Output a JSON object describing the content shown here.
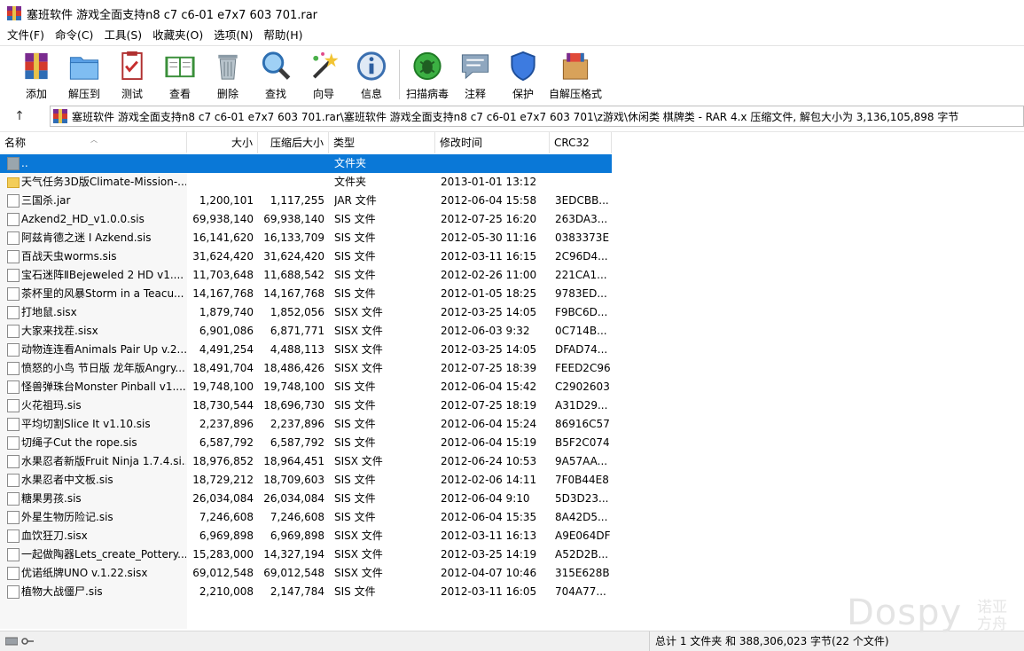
{
  "window": {
    "title": "塞班软件 游戏全面支持n8 c7 c6-01 e7x7 603 701.rar"
  },
  "menu": [
    "文件(F)",
    "命令(C)",
    "工具(S)",
    "收藏夹(O)",
    "选项(N)",
    "帮助(H)"
  ],
  "toolbar": [
    {
      "label": "添加",
      "icon": "add-archive-icon"
    },
    {
      "label": "解压到",
      "icon": "extract-to-icon"
    },
    {
      "label": "测试",
      "icon": "test-icon"
    },
    {
      "label": "查看",
      "icon": "view-icon"
    },
    {
      "label": "删除",
      "icon": "delete-icon"
    },
    {
      "label": "查找",
      "icon": "find-icon"
    },
    {
      "label": "向导",
      "icon": "wizard-icon"
    },
    {
      "label": "信息",
      "icon": "info-icon"
    },
    {
      "label": "扫描病毒",
      "icon": "virus-scan-icon"
    },
    {
      "label": "注释",
      "icon": "comment-icon"
    },
    {
      "label": "保护",
      "icon": "protect-icon"
    },
    {
      "label": "自解压格式",
      "icon": "sfx-icon"
    }
  ],
  "address": {
    "up_arrow": "↑",
    "path": "塞班软件 游戏全面支持n8 c7 c6-01 e7x7 603 701.rar\\塞班软件 游戏全面支持n8 c7 c6-01 e7x7 603 701\\z游戏\\休闲类 棋牌类 - RAR 4.x 压缩文件, 解包大小为 3,136,105,898 字节"
  },
  "columns": {
    "name": "名称",
    "size": "大小",
    "packed": "压缩后大小",
    "type": "类型",
    "modified": "修改时间",
    "crc": "CRC32"
  },
  "rows": [
    {
      "name": "..",
      "size": "",
      "packed": "",
      "type": "文件夹",
      "modified": "",
      "crc": "",
      "kind": "up"
    },
    {
      "name": "天气任务3D版Climate-Mission-...",
      "size": "",
      "packed": "",
      "type": "文件夹",
      "modified": "2013-01-01 13:12",
      "crc": "",
      "kind": "folder"
    },
    {
      "name": "三国杀.jar",
      "size": "1,200,101",
      "packed": "1,117,255",
      "type": "JAR 文件",
      "modified": "2012-06-04 15:58",
      "crc": "3EDCBB...",
      "kind": "file"
    },
    {
      "name": "Azkend2_HD_v1.0.0.sis",
      "size": "69,938,140",
      "packed": "69,938,140",
      "type": "SIS 文件",
      "modified": "2012-07-25 16:20",
      "crc": "263DA3...",
      "kind": "file"
    },
    {
      "name": "阿兹肯德之迷 I Azkend.sis",
      "size": "16,141,620",
      "packed": "16,133,709",
      "type": "SIS 文件",
      "modified": "2012-05-30 11:16",
      "crc": "0383373E",
      "kind": "file"
    },
    {
      "name": "百战天虫worms.sis",
      "size": "31,624,420",
      "packed": "31,624,420",
      "type": "SIS 文件",
      "modified": "2012-03-11 16:15",
      "crc": "2C96D4...",
      "kind": "file"
    },
    {
      "name": "宝石迷阵ⅡBejeweled 2 HD v1....",
      "size": "11,703,648",
      "packed": "11,688,542",
      "type": "SIS 文件",
      "modified": "2012-02-26 11:00",
      "crc": "221CA1...",
      "kind": "file"
    },
    {
      "name": "茶杯里的风暴Storm in a Teacu...",
      "size": "14,167,768",
      "packed": "14,167,768",
      "type": "SIS 文件",
      "modified": "2012-01-05 18:25",
      "crc": "9783ED...",
      "kind": "file"
    },
    {
      "name": "打地鼠.sisx",
      "size": "1,879,740",
      "packed": "1,852,056",
      "type": "SISX 文件",
      "modified": "2012-03-25 14:05",
      "crc": "F9BC6D...",
      "kind": "file"
    },
    {
      "name": "大家来找茬.sisx",
      "size": "6,901,086",
      "packed": "6,871,771",
      "type": "SISX 文件",
      "modified": "2012-06-03 9:32",
      "crc": "0C714B...",
      "kind": "file"
    },
    {
      "name": "动物连连看Animals Pair Up v.2....",
      "size": "4,491,254",
      "packed": "4,488,113",
      "type": "SISX 文件",
      "modified": "2012-03-25 14:05",
      "crc": "DFAD74...",
      "kind": "file"
    },
    {
      "name": "愤怒的小鸟 节日版 龙年版Angry...",
      "size": "18,491,704",
      "packed": "18,486,426",
      "type": "SISX 文件",
      "modified": "2012-07-25 18:39",
      "crc": "FEED2C96",
      "kind": "file"
    },
    {
      "name": "怪兽弹珠台Monster Pinball v1....",
      "size": "19,748,100",
      "packed": "19,748,100",
      "type": "SIS 文件",
      "modified": "2012-06-04 15:42",
      "crc": "C2902603",
      "kind": "file"
    },
    {
      "name": "火花祖玛.sis",
      "size": "18,730,544",
      "packed": "18,696,730",
      "type": "SIS 文件",
      "modified": "2012-07-25 18:19",
      "crc": "A31D29...",
      "kind": "file"
    },
    {
      "name": "平均切割Slice It v1.10.sis",
      "size": "2,237,896",
      "packed": "2,237,896",
      "type": "SIS 文件",
      "modified": "2012-06-04 15:24",
      "crc": "86916C57",
      "kind": "file"
    },
    {
      "name": "切绳子Cut the rope.sis",
      "size": "6,587,792",
      "packed": "6,587,792",
      "type": "SIS 文件",
      "modified": "2012-06-04 15:19",
      "crc": "B5F2C074",
      "kind": "file"
    },
    {
      "name": "水果忍者新版Fruit Ninja 1.7.4.si...",
      "size": "18,976,852",
      "packed": "18,964,451",
      "type": "SISX 文件",
      "modified": "2012-06-24 10:53",
      "crc": "9A57AA...",
      "kind": "file"
    },
    {
      "name": "水果忍者中文板.sis",
      "size": "18,729,212",
      "packed": "18,709,603",
      "type": "SIS 文件",
      "modified": "2012-02-06 14:11",
      "crc": "7F0B44E8",
      "kind": "file"
    },
    {
      "name": "糖果男孩.sis",
      "size": "26,034,084",
      "packed": "26,034,084",
      "type": "SIS 文件",
      "modified": "2012-06-04 9:10",
      "crc": "5D3D23...",
      "kind": "file"
    },
    {
      "name": "外星生物历险记.sis",
      "size": "7,246,608",
      "packed": "7,246,608",
      "type": "SIS 文件",
      "modified": "2012-06-04 15:35",
      "crc": "8A42D5...",
      "kind": "file"
    },
    {
      "name": "血饮狂刀.sisx",
      "size": "6,969,898",
      "packed": "6,969,898",
      "type": "SISX 文件",
      "modified": "2012-03-11 16:13",
      "crc": "A9E064DF",
      "kind": "file"
    },
    {
      "name": "一起做陶器Lets_create_Pottery....",
      "size": "15,283,000",
      "packed": "14,327,194",
      "type": "SISX 文件",
      "modified": "2012-03-25 14:19",
      "crc": "A52D2B...",
      "kind": "file"
    },
    {
      "name": "优诺纸牌UNO v.1.22.sisx",
      "size": "69,012,548",
      "packed": "69,012,548",
      "type": "SISX 文件",
      "modified": "2012-04-07 10:46",
      "crc": "315E628B",
      "kind": "file"
    },
    {
      "name": "植物大战僵尸.sis",
      "size": "2,210,008",
      "packed": "2,147,784",
      "type": "SIS 文件",
      "modified": "2012-03-11 16:05",
      "crc": "704A77...",
      "kind": "file"
    }
  ],
  "status": {
    "summary": "总计 1 文件夹 和 388,306,023 字节(22 个文件)"
  },
  "watermark": {
    "latin": "Dospy",
    "cn": "诺亚方舟"
  }
}
